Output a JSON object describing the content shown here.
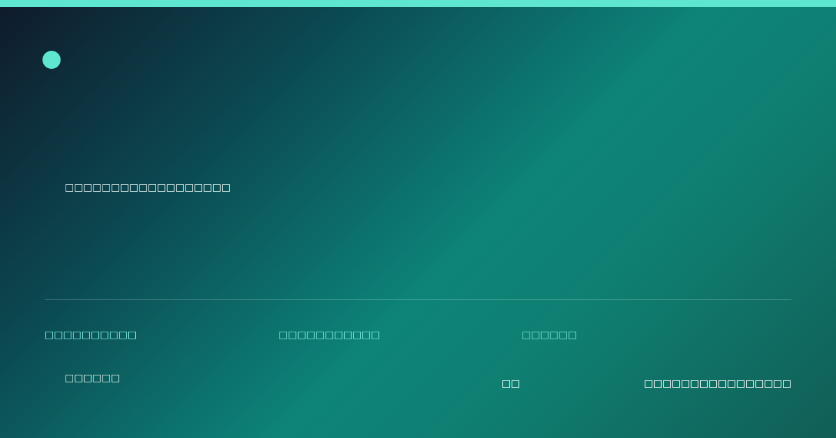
{
  "colors": {
    "accent": "#5fe6d0",
    "label": "#7ff0dc",
    "gradient_start": "#0f1a2b",
    "gradient_mid": "#0d8478",
    "gradient_end": "#115e56"
  },
  "brand": {
    "logo_icon": "circle-dot-icon"
  },
  "headline": "□□□□□□□□□□□□□□□□□□",
  "stats": [
    {
      "label": "□□□□□□□□□□"
    },
    {
      "label": "□□□□□□□□□□□"
    },
    {
      "label": "□□□□□□"
    }
  ],
  "sub_value": "□□□□□□",
  "footer": {
    "tag": "□□",
    "right_text": "□□□□□□□□□□□□□□□□"
  }
}
